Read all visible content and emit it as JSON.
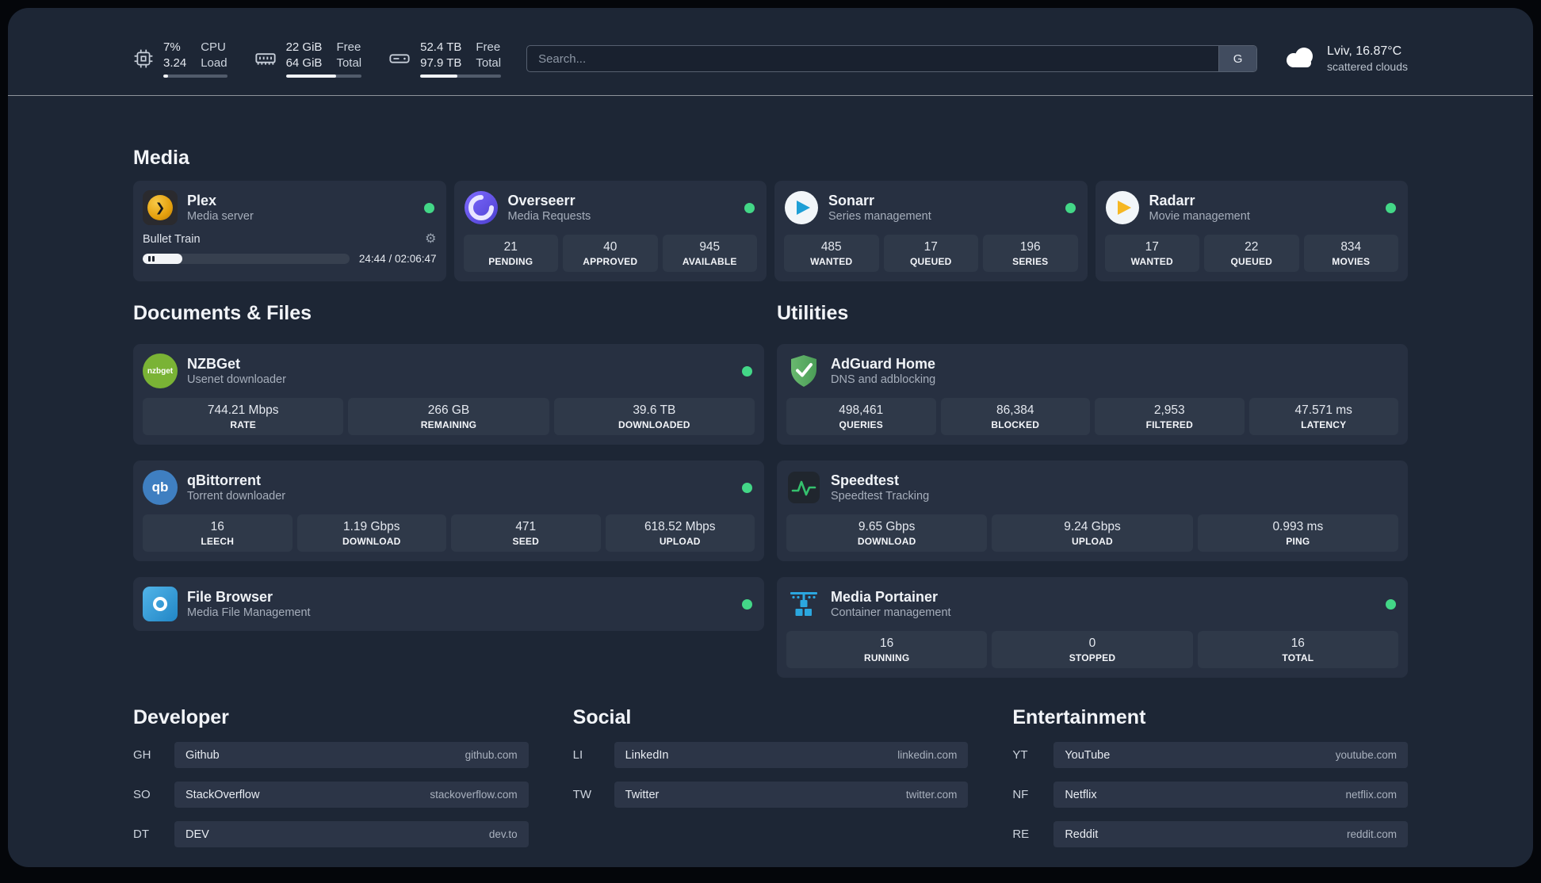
{
  "topbar": {
    "resources": [
      {
        "value_top": "7%",
        "value_bottom": "3.24",
        "label_top": "CPU",
        "label_bottom": "Load",
        "progress": 7
      },
      {
        "value_top": "22 GiB",
        "value_bottom": "64 GiB",
        "label_top": "Free",
        "label_bottom": "Total",
        "progress": 66
      },
      {
        "value_top": "52.4 TB",
        "value_bottom": "97.9 TB",
        "label_top": "Free",
        "label_bottom": "Total",
        "progress": 46
      }
    ],
    "search": {
      "placeholder": "Search...",
      "provider": "G"
    },
    "weather": {
      "location": "Lviv, 16.87°C",
      "condition": "scattered clouds"
    }
  },
  "icons": {
    "gear": "⚙",
    "plex_chevron": "❯",
    "nzbget_label": "nzbget",
    "qbittorrent_label": "qb"
  },
  "colors": {
    "status_online": "#43d787",
    "accent_gold": "#e5a00d"
  },
  "sections": {
    "media": {
      "heading": "Media",
      "cards": {
        "plex": {
          "name": "Plex",
          "desc": "Media server",
          "status": "online",
          "player_title": "Bullet Train",
          "player_time": "24:44 / 02:06:47",
          "player_progress": 19
        },
        "overseerr": {
          "name": "Overseerr",
          "desc": "Media Requests",
          "status": "online",
          "stats": [
            {
              "value": "21",
              "label": "PENDING"
            },
            {
              "value": "40",
              "label": "APPROVED"
            },
            {
              "value": "945",
              "label": "AVAILABLE"
            }
          ]
        },
        "sonarr": {
          "name": "Sonarr",
          "desc": "Series management",
          "status": "online",
          "stats": [
            {
              "value": "485",
              "label": "WANTED"
            },
            {
              "value": "17",
              "label": "QUEUED"
            },
            {
              "value": "196",
              "label": "SERIES"
            }
          ]
        },
        "radarr": {
          "name": "Radarr",
          "desc": "Movie management",
          "status": "online",
          "stats": [
            {
              "value": "17",
              "label": "WANTED"
            },
            {
              "value": "22",
              "label": "QUEUED"
            },
            {
              "value": "834",
              "label": "MOVIES"
            }
          ]
        }
      }
    },
    "documents": {
      "heading": "Documents & Files",
      "cards": {
        "nzbget": {
          "name": "NZBGet",
          "desc": "Usenet downloader",
          "status": "online",
          "stats": [
            {
              "value": "744.21 Mbps",
              "label": "RATE"
            },
            {
              "value": "266 GB",
              "label": "REMAINING"
            },
            {
              "value": "39.6 TB",
              "label": "DOWNLOADED"
            }
          ]
        },
        "qbittorrent": {
          "name": "qBittorrent",
          "desc": "Torrent downloader",
          "status": "online",
          "stats": [
            {
              "value": "16",
              "label": "LEECH"
            },
            {
              "value": "1.19 Gbps",
              "label": "DOWNLOAD"
            },
            {
              "value": "471",
              "label": "SEED"
            },
            {
              "value": "618.52 Mbps",
              "label": "UPLOAD"
            }
          ]
        },
        "filebrowser": {
          "name": "File Browser",
          "desc": "Media File Management",
          "status": "online"
        }
      }
    },
    "utilities": {
      "heading": "Utilities",
      "cards": {
        "adguard": {
          "name": "AdGuard Home",
          "desc": "DNS and adblocking",
          "stats": [
            {
              "value": "498,461",
              "label": "QUERIES"
            },
            {
              "value": "86,384",
              "label": "BLOCKED"
            },
            {
              "value": "2,953",
              "label": "FILTERED"
            },
            {
              "value": "47.571 ms",
              "label": "LATENCY"
            }
          ]
        },
        "speedtest": {
          "name": "Speedtest",
          "desc": "Speedtest Tracking",
          "stats": [
            {
              "value": "9.65 Gbps",
              "label": "DOWNLOAD"
            },
            {
              "value": "9.24 Gbps",
              "label": "UPLOAD"
            },
            {
              "value": "0.993 ms",
              "label": "PING"
            }
          ]
        },
        "portainer": {
          "name": "Media Portainer",
          "desc": "Container management",
          "status": "online",
          "stats": [
            {
              "value": "16",
              "label": "RUNNING"
            },
            {
              "value": "0",
              "label": "STOPPED"
            },
            {
              "value": "16",
              "label": "TOTAL"
            }
          ]
        }
      }
    },
    "bookmarks": [
      {
        "heading": "Developer",
        "items": [
          {
            "abbr": "GH",
            "name": "Github",
            "url": "github.com"
          },
          {
            "abbr": "SO",
            "name": "StackOverflow",
            "url": "stackoverflow.com"
          },
          {
            "abbr": "DT",
            "name": "DEV",
            "url": "dev.to"
          }
        ]
      },
      {
        "heading": "Social",
        "items": [
          {
            "abbr": "LI",
            "name": "LinkedIn",
            "url": "linkedin.com"
          },
          {
            "abbr": "TW",
            "name": "Twitter",
            "url": "twitter.com"
          }
        ]
      },
      {
        "heading": "Entertainment",
        "items": [
          {
            "abbr": "YT",
            "name": "YouTube",
            "url": "youtube.com"
          },
          {
            "abbr": "NF",
            "name": "Netflix",
            "url": "netflix.com"
          },
          {
            "abbr": "RE",
            "name": "Reddit",
            "url": "reddit.com"
          }
        ]
      }
    ]
  }
}
